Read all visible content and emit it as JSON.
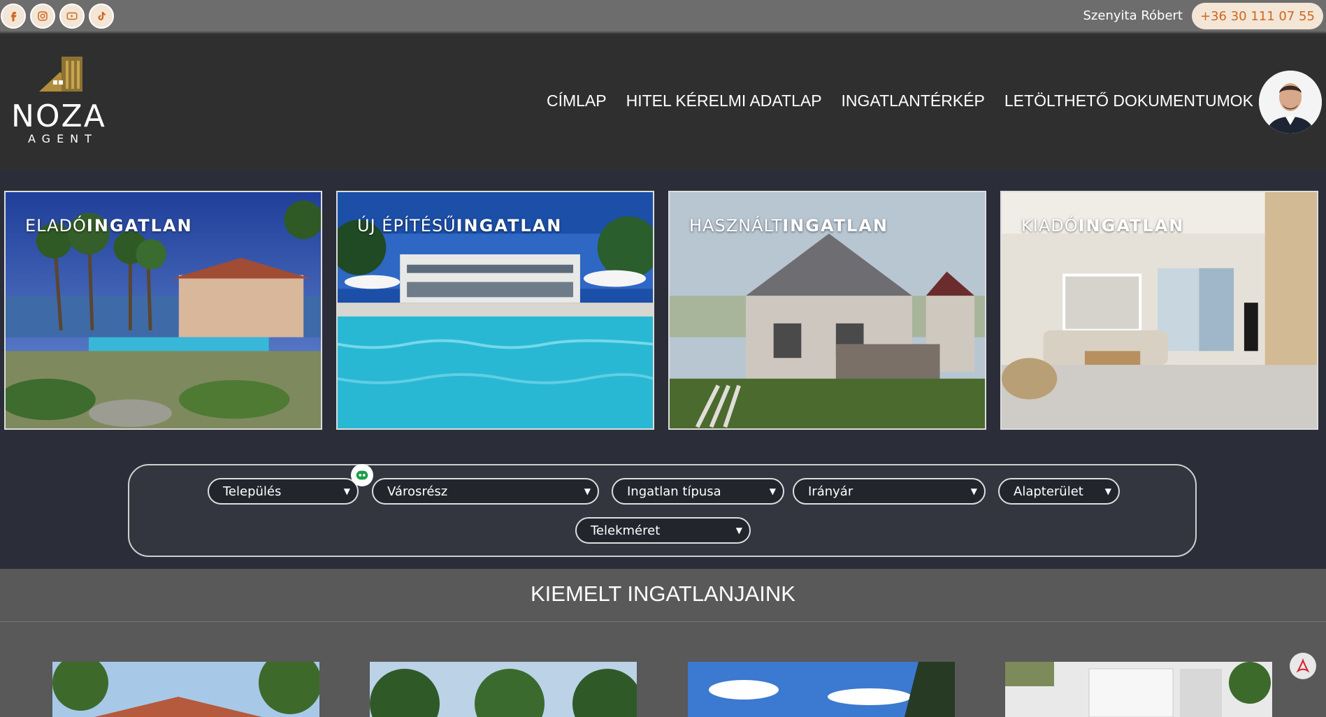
{
  "topbar": {
    "social": [
      "facebook-icon",
      "instagram-icon",
      "youtube-icon",
      "tiktok-icon"
    ],
    "agent_name": "Szenyita Róbert",
    "phone": "+36 30 111 07 55"
  },
  "logo": {
    "name": "NOZA",
    "sub": "AGENT"
  },
  "nav": {
    "items": [
      "CÍMLAP",
      "HITEL KÉRELMI ADATLAP",
      "INGATLANTÉRKÉP",
      "LETÖLTHETŐ DOKUMENTUMOK"
    ]
  },
  "categories": [
    {
      "prefix": "ELADÓ",
      "bold": "INGATLAN"
    },
    {
      "prefix": "ÚJ ÉPÍTÉSŰ",
      "bold": "INGATLAN"
    },
    {
      "prefix": "HASZNÁLT",
      "bold": "INGATLAN"
    },
    {
      "prefix": "KIADÓ",
      "bold": "INGATLAN"
    }
  ],
  "filters": {
    "telepules": "Település",
    "varosresz": "Városrész",
    "tipus": "Ingatlan típusa",
    "iranyar": "Irányár",
    "alapterulet": "Alapterület",
    "telekmeret": "Telekméret"
  },
  "featured": {
    "title": "KIEMELT INGATLANJAINK"
  },
  "colors": {
    "accent": "#d0661e",
    "dark": "#2b2e38",
    "phone_bg": "#f3e6d6"
  }
}
